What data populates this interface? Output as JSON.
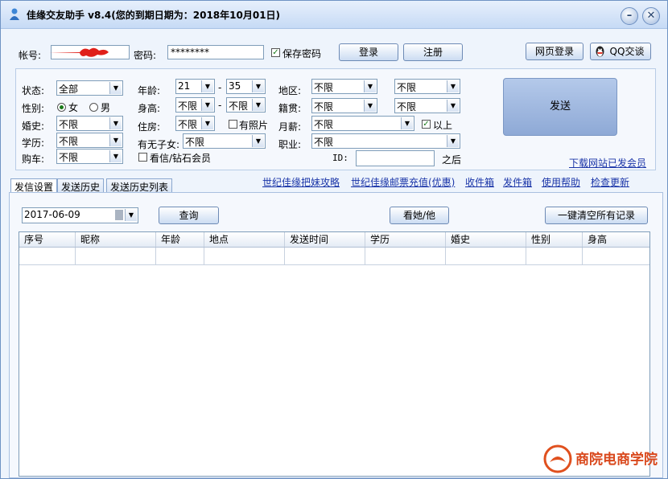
{
  "titlebar": {
    "title": "佳缘交友助手 v8.4(您的到期日期为：2018年10月01日)",
    "minimize": "–",
    "close": "✕"
  },
  "login": {
    "account_label": "帐号:",
    "account_value": "",
    "password_label": "密码:",
    "password_value": "********",
    "save_password_label": "保存密码",
    "login_button": "登录",
    "register_button": "注册",
    "web_login_button": "网页登录",
    "qq_button": "QQ交谈"
  },
  "filters": {
    "status_label": "状态:",
    "status_value": "全部",
    "gender_label": "性别:",
    "gender_female": "女",
    "gender_male": "男",
    "marriage_label": "婚史:",
    "marriage_value": "不限",
    "education_label": "学历:",
    "education_value": "不限",
    "car_label": "购车:",
    "car_value": "不限",
    "age_label": "年龄:",
    "age_min": "21",
    "age_dash": "-",
    "age_max": "35",
    "height_label": "身高:",
    "height_min": "不限",
    "height_dash": "-",
    "height_max": "不限",
    "housing_label": "住房:",
    "housing_value": "不限",
    "has_photo_label": "有照片",
    "children_label": "有无子女:",
    "children_value": "不限",
    "vip_label": "看信/钻石会员",
    "region_label": "地区:",
    "region_value1": "不限",
    "region_value2": "不限",
    "origin_label": "籍贯:",
    "origin_value1": "不限",
    "origin_value2": "不限",
    "salary_label": "月薪:",
    "salary_value": "不限",
    "above_label": "以上",
    "job_label": "职业:",
    "job_value": "不限",
    "id_label": "ID:",
    "id_value": "",
    "after_label": "之后",
    "send_button": "发送",
    "download_link": "下载网站已发会员"
  },
  "tabs": [
    {
      "label": "发信设置"
    },
    {
      "label": "发送历史"
    },
    {
      "label": "发送历史列表"
    }
  ],
  "links": [
    "世纪佳缘把妹攻略",
    "世纪佳缘邮票充值(优惠)",
    "收件箱",
    "发件箱",
    "使用帮助",
    "检查更新"
  ],
  "history": {
    "date_value": "2017-06-09",
    "query_button": "查询",
    "view_button": "看她/他",
    "clear_button": "一键清空所有记录",
    "columns": [
      "序号",
      "昵称",
      "年龄",
      "地点",
      "发送时间",
      "学历",
      "婚史",
      "性别",
      "身高"
    ]
  },
  "watermark": {
    "text": "商院电商学院"
  }
}
